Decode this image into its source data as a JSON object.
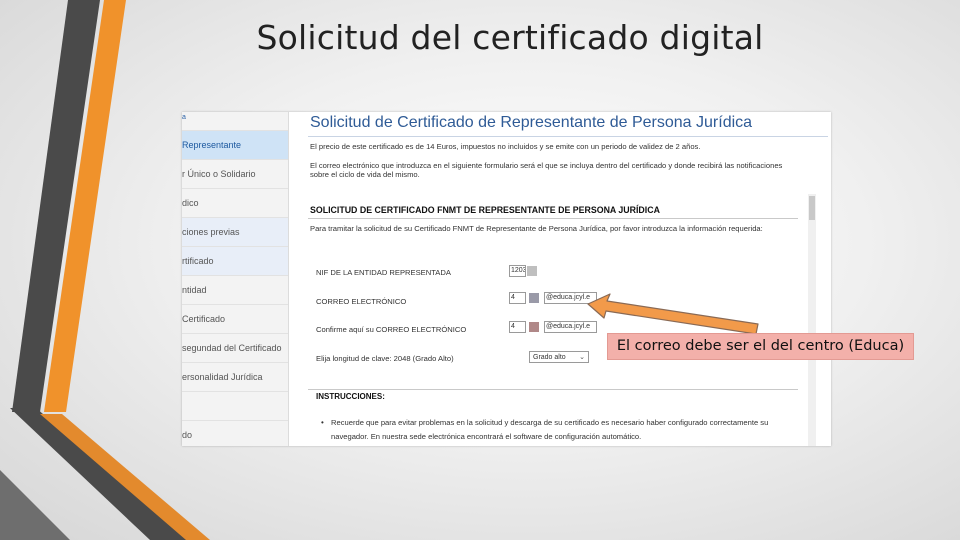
{
  "slide": {
    "title": "Solicitud del certificado digital",
    "callout": "El correo debe ser el del centro (Educa)"
  },
  "colors": {
    "accent_orange": "#F0922B",
    "deco_gray": "#4A4A4A",
    "heading_blue": "#2F5B96",
    "callout_fill": "#F3B0AA",
    "arrow_fill": "#F29A4A"
  },
  "sidebar": {
    "items": [
      {
        "label": "a",
        "state": "first"
      },
      {
        "label": "Representante",
        "state": "active"
      },
      {
        "label": "r Único o Solidario",
        "state": "normal"
      },
      {
        "label": "dico",
        "state": "normal"
      },
      {
        "label": "ciones previas",
        "state": "light"
      },
      {
        "label": "rtificado",
        "state": "light"
      },
      {
        "label": "ntidad",
        "state": "normal"
      },
      {
        "label": "Certificado",
        "state": "normal"
      },
      {
        "label": "segundad del Certificado",
        "state": "normal"
      },
      {
        "label": "ersonalidad Jurídica",
        "state": "normal"
      },
      {
        "label": "",
        "state": "normal"
      },
      {
        "label": "do",
        "state": "normal"
      }
    ]
  },
  "page": {
    "heading": "Solicitud de Certificado de Representante de Persona Jurídica",
    "p1": "El precio de este certificado es de 14 Euros, impuestos no incluidos y se emite con un periodo de validez de 2 años.",
    "p2": "El correo electrónico que introduzca en el siguiente formulario será el que se incluya dentro del certificado y donde recibirá las notificaciones",
    "p3": "sobre el ciclo de vida del mismo."
  },
  "form": {
    "title": "SOLICITUD DE CERTIFICADO FNMT DE REPRESENTANTE DE PERSONA JURÍDICA",
    "intro": "Para tramitar la solicitud de su Certificado FNMT de Representante de Persona Jurídica, por favor introduzca la información requerida:",
    "nif_label": "NIF DE LA ENTIDAD REPRESENTADA",
    "nif_value": "1203",
    "email_label": "CORREO ELECTRÓNICO",
    "email_prefix": "4",
    "email_domain": "@educa.jcyl.e",
    "email_confirm_label": "Confirme aquí su CORREO ELECTRÓNICO",
    "email_confirm_prefix": "4",
    "email_confirm_domain": "@educa.jcyl.e",
    "key_label": "Elija longitud de clave: 2048 (Grado Alto)",
    "key_value": "Grado alto"
  },
  "instructions": {
    "title": "INSTRUCCIONES:",
    "line1": "Recuerde que para evitar problemas en la solicitud y descarga de su certificado es necesario haber configurado correctamente su",
    "line2": "navegador. En nuestra sede electrónica encontrará el software de configuración automático."
  }
}
